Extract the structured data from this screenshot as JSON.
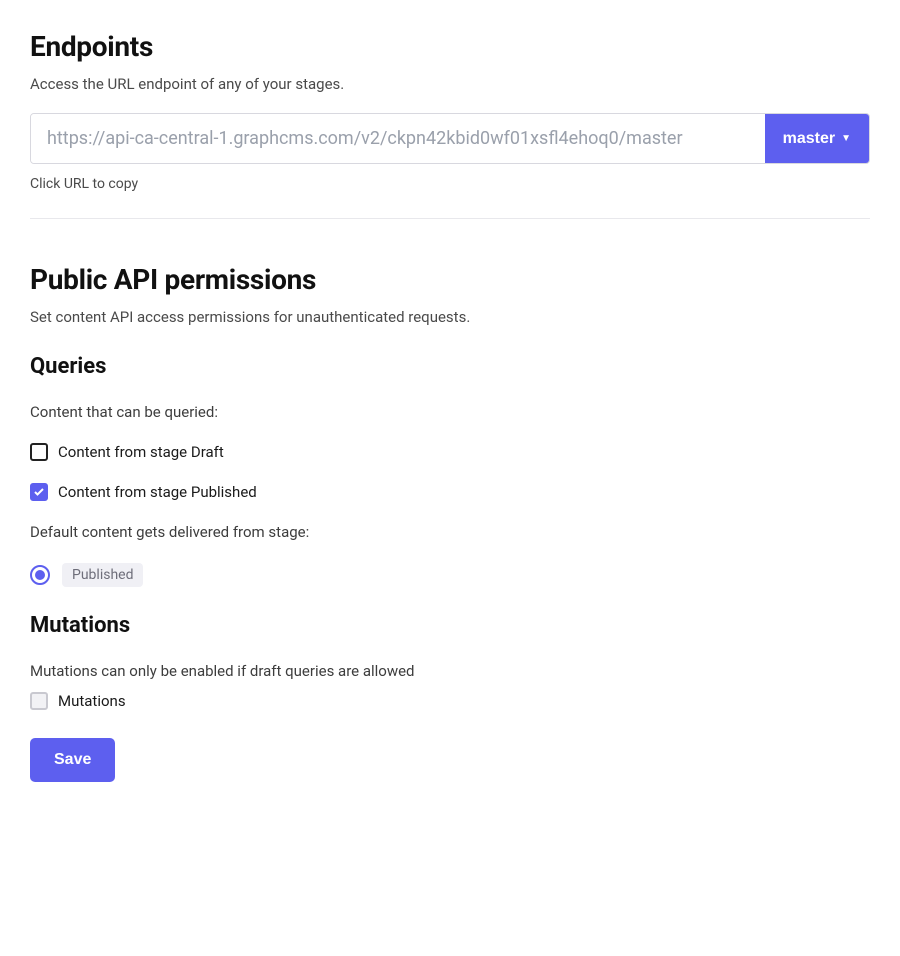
{
  "endpoints": {
    "title": "Endpoints",
    "desc": "Access the URL endpoint of any of your stages.",
    "url": "https://api-ca-central-1.graphcms.com/v2/ckpn42kbid0wf01xsfl4ehoq0/master",
    "stage_selected": "master",
    "hint": "Click URL to copy"
  },
  "permissions": {
    "title": "Public API permissions",
    "desc": "Set content API access permissions for unauthenticated requests.",
    "queries": {
      "heading": "Queries",
      "label": "Content that can be queried:",
      "options": {
        "draft": {
          "label": "Content from stage Draft",
          "checked": false
        },
        "published": {
          "label": "Content from stage Published",
          "checked": true
        }
      },
      "default_stage_label": "Default content gets delivered from stage:",
      "default_stage_value": "Published"
    },
    "mutations": {
      "heading": "Mutations",
      "note": "Mutations can only be enabled if draft queries are allowed",
      "option": {
        "label": "Mutations",
        "checked": false,
        "disabled": true
      }
    },
    "save_label": "Save"
  }
}
